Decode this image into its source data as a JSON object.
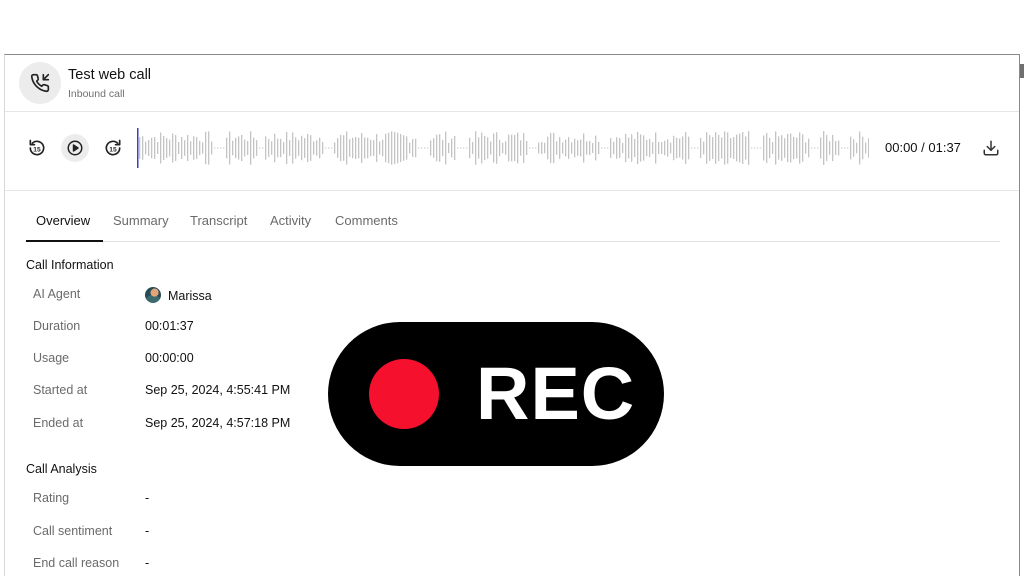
{
  "header": {
    "title": "Test web call",
    "subtitle": "Inbound call",
    "icon": "phone-incoming-icon"
  },
  "player": {
    "rewind_icon": "rewind-15-icon",
    "play_icon": "play-icon",
    "forward_icon": "forward-15-icon",
    "current_time": "00:00",
    "separator": " / ",
    "total_time": "01:37",
    "time_display": "00:00 / 01:37",
    "download_icon": "download-icon",
    "progress": 0,
    "colors": {
      "waveform": "#c4c4c4",
      "playhead": "#3f3fbf"
    }
  },
  "tabs": [
    {
      "label": "Overview",
      "active": true
    },
    {
      "label": "Summary",
      "active": false
    },
    {
      "label": "Transcript",
      "active": false
    },
    {
      "label": "Activity",
      "active": false
    },
    {
      "label": "Comments",
      "active": false
    }
  ],
  "call_information": {
    "title": "Call Information",
    "fields": [
      {
        "label": "AI Agent",
        "value": "Marissa"
      },
      {
        "label": "Duration",
        "value": "00:01:37"
      },
      {
        "label": "Usage",
        "value": "00:00:00"
      },
      {
        "label": "Started at",
        "value": "Sep 25, 2024, 4:55:41 PM"
      },
      {
        "label": "Ended at",
        "value": "Sep 25, 2024, 4:57:18 PM"
      }
    ]
  },
  "call_analysis": {
    "title": "Call Analysis",
    "fields": [
      {
        "label": "Rating",
        "value": "-"
      },
      {
        "label": "Call sentiment",
        "value": "-"
      },
      {
        "label": "End call reason",
        "value": "-"
      }
    ]
  },
  "overlay": {
    "text": "REC",
    "dot_color": "#f5102d",
    "background": "#000000"
  }
}
